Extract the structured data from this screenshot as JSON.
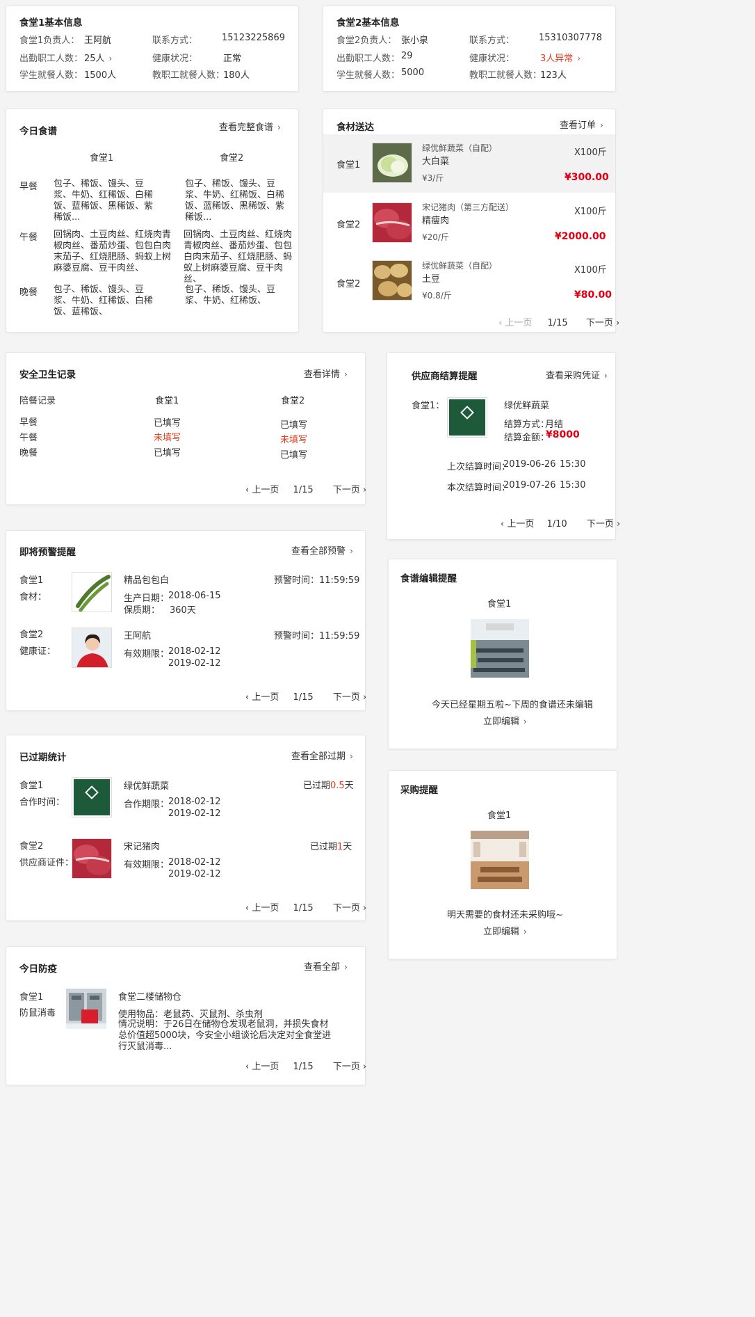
{
  "c1": {
    "title": "食堂1基本信息",
    "manager_label": "食堂1负责人：",
    "manager": "王阿航",
    "contact_label": "联系方式：",
    "contact": "15123225869",
    "staff_label": "出勤职工人数：",
    "staff": "25人",
    "health_label": "健康状况：",
    "health": "正常",
    "students_label": "学生就餐人数：",
    "students": "1500人",
    "teachers_label": "教职工就餐人数：",
    "teachers": "180人"
  },
  "c2": {
    "title": "食堂2基本信息",
    "manager_label": "食堂2负责人：",
    "manager": "张小泉",
    "contact_label": "联系方式：",
    "contact": "15310307778",
    "staff_label": "出勤职工人数：",
    "staff": "29",
    "health_label": "健康状况：",
    "health": "3人异常",
    "students_label": "学生就餐人数：",
    "students": "5000",
    "teachers_label": "教职工就餐人数：",
    "teachers": "123人"
  },
  "menu": {
    "title": "今日食谱",
    "link": "查看完整食谱",
    "col1": "食堂1",
    "col2": "食堂2",
    "breakfast_label": "早餐",
    "lunch_label": "午餐",
    "dinner_label": "晚餐",
    "b1": "包子、稀饭、馒头、豆浆、牛奶、红稀饭、白稀饭、蓝稀饭、黑稀饭、紫稀饭...",
    "b2": "包子、稀饭、馒头、豆浆、牛奶、红稀饭、白稀饭、蓝稀饭、黑稀饭、紫稀饭...",
    "l1": "回锅肉、土豆肉丝、红烧肉青椒肉丝、番茄炒蛋、包包白肉末茄子、红烧肥肠、蚂蚁上树麻婆豆腐、豆干肉丝、",
    "l2": "回锅肉、土豆肉丝、红烧肉青椒肉丝、番茄炒蛋、包包白肉末茄子、红烧肥肠、蚂蚁上树麻婆豆腐、豆干肉丝、",
    "d1": "包子、稀饭、馒头、豆浆、牛奶、红稀饭、白稀饭、蓝稀饭、",
    "d2": "包子、稀饭、馒头、豆浆、牛奶、红稀饭、"
  },
  "delivery": {
    "title": "食材送达",
    "link": "查看订单",
    "items": [
      {
        "canteen": "食堂1",
        "supplier": "绿优鲜蔬菜（自配）",
        "name": "大白菜",
        "unit_price": "¥3/斤",
        "qty": "X100斤",
        "total": "¥300.00"
      },
      {
        "canteen": "食堂2",
        "supplier": "宋记猪肉（第三方配送）",
        "name": "精瘦肉",
        "unit_price": "¥20/斤",
        "qty": "X100斤",
        "total": "¥2000.00"
      },
      {
        "canteen": "食堂2",
        "supplier": "绿优鲜蔬菜（自配）",
        "name": "土豆",
        "unit_price": "¥0.8/斤",
        "qty": "X100斤",
        "total": "¥80.00"
      }
    ],
    "prev": "上一页",
    "page": "1/15",
    "next": "下一页"
  },
  "safety": {
    "title": "安全卫生记录",
    "link": "查看详情",
    "h0": "陪餐记录",
    "h1": "食堂1",
    "h2": "食堂2",
    "rows": [
      {
        "meal": "早餐",
        "c1": "已填写",
        "c2": "已填写"
      },
      {
        "meal": "午餐",
        "c1": "未填写",
        "c2": "未填写"
      },
      {
        "meal": "晚餐",
        "c1": "已填写",
        "c2": "已填写"
      }
    ],
    "prev": "上一页",
    "page": "1/15",
    "next": "下一页"
  },
  "settle": {
    "title": "供应商结算提醒",
    "link": "查看采购凭证",
    "canteen": "食堂1：",
    "supplier": "绿优鲜蔬菜",
    "method_label": "结算方式：",
    "method": "月结",
    "amount_label": "结算金额：",
    "amount": "¥8000",
    "last_label": "上次结算时间：",
    "last_date": "2019-06-26",
    "last_time": "15:30",
    "this_label": "本次结算时间：",
    "this_date": "2019-07-26",
    "this_time": "15:30",
    "prev": "上一页",
    "page": "1/10",
    "next": "下一页"
  },
  "warn": {
    "title": "即将预警提醒",
    "link": "查看全部预警",
    "i1_canteen": "食堂1",
    "i1_type": "食材：",
    "i1_name": "精品包包白",
    "i1_time": "预警时间：11:59:59",
    "i1_prod_label": "生产日期：",
    "i1_prod": "2018-06-15",
    "i1_shelf_label": "保质期：",
    "i1_shelf": "360天",
    "i2_canteen": "食堂2",
    "i2_type": "健康证：",
    "i2_name": "王阿航",
    "i2_time": "预警时间：11:59:59",
    "i2_valid_label": "有效期限：",
    "i2_from": "2018-02-12",
    "i2_to": "2019-02-12",
    "prev": "上一页",
    "page": "1/15",
    "next": "下一页"
  },
  "menuedit": {
    "title": "食谱编辑提醒",
    "canteen": "食堂1",
    "msg": "今天已经星期五啦~下周的食谱还未编辑",
    "action": "立即编辑"
  },
  "expired": {
    "title": "已过期统计",
    "link": "查看全部过期",
    "i1_canteen": "食堂1",
    "i1_type": "合作时间：",
    "i1_name": "绿优鲜蔬菜",
    "i1_status_pre": "已过期",
    "i1_days": "0.5",
    "i1_status_post": "天",
    "i1_label": "合作期限：",
    "i1_from": "2018-02-12",
    "i1_to": "2019-02-12",
    "i2_canteen": "食堂2",
    "i2_type": "供应商证件：",
    "i2_name": "宋记猪肉",
    "i2_status_pre": "已过期",
    "i2_days": "1",
    "i2_status_post": "天",
    "i2_label": "有效期限：",
    "i2_from": "2018-02-12",
    "i2_to": "2019-02-12",
    "prev": "上一页",
    "page": "1/15",
    "next": "下一页"
  },
  "purchase": {
    "title": "采购提醒",
    "canteen": "食堂1",
    "msg": "明天需要的食材还未采购哦~",
    "action": "立即编辑"
  },
  "epidemic": {
    "title": "今日防疫",
    "link": "查看全部",
    "canteen": "食堂1",
    "type": "防鼠消毒",
    "place": "食堂二楼储物仓",
    "items": "使用物品：老鼠药、灭鼠剂、杀虫剂",
    "desc": "情况说明：于26日在储物仓发现老鼠洞，并损失食材总价值超5000块，今安全小组谈论后决定对全食堂进行灭鼠消毒...",
    "prev": "上一页",
    "page": "1/15",
    "next": "下一页"
  },
  "logo_text": "绿优鲜"
}
